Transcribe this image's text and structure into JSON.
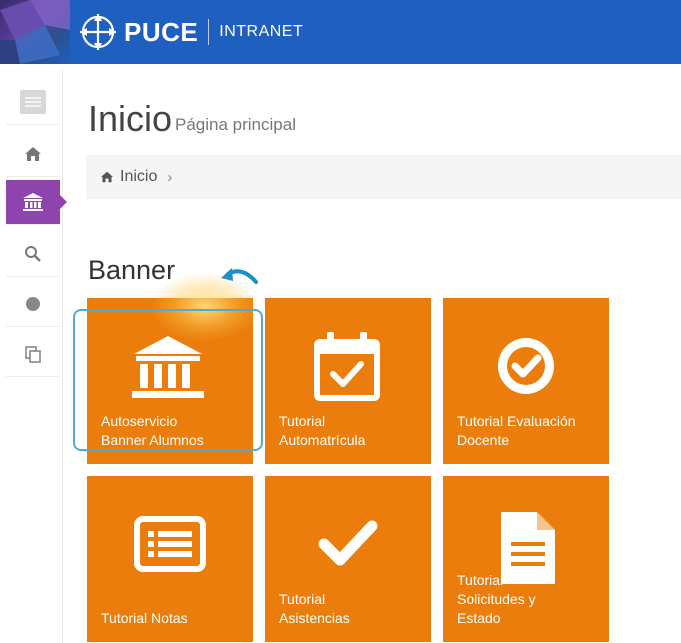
{
  "header": {
    "brand": "PUCE",
    "subtitle": "INTRANET"
  },
  "colors": {
    "topbar": "#1f5fbf",
    "tile": "#ea7d0b",
    "active_sidebar": "#8e44ad",
    "highlight": "#5aa8c8"
  },
  "sidebar": {
    "items": [
      {
        "icon": "menu-toggle-icon"
      },
      {
        "icon": "home-icon"
      },
      {
        "icon": "institution-icon",
        "active": true
      },
      {
        "icon": "search-icon"
      },
      {
        "icon": "circle-icon"
      },
      {
        "icon": "copy-icon"
      }
    ]
  },
  "page": {
    "title": "Inicio",
    "subtitle": "Página principal"
  },
  "breadcrumb": {
    "home_label": "Inicio",
    "separator": "›"
  },
  "section": {
    "title": "Banner"
  },
  "tiles": [
    {
      "label": "Autoservicio\nBanner Alumnos",
      "icon": "institution-icon"
    },
    {
      "label": "Tutorial\nAutomatrícula",
      "icon": "calendar-check-icon"
    },
    {
      "label": "Tutorial Evaluación\nDocente",
      "icon": "check-circle-icon"
    },
    {
      "label": "Tutorial Notas",
      "icon": "list-card-icon"
    },
    {
      "label": "Tutorial\nAsistencias",
      "icon": "checkmark-icon"
    },
    {
      "label": "Tutorial\nSolicitudes y\nEstado",
      "icon": "document-icon"
    }
  ]
}
